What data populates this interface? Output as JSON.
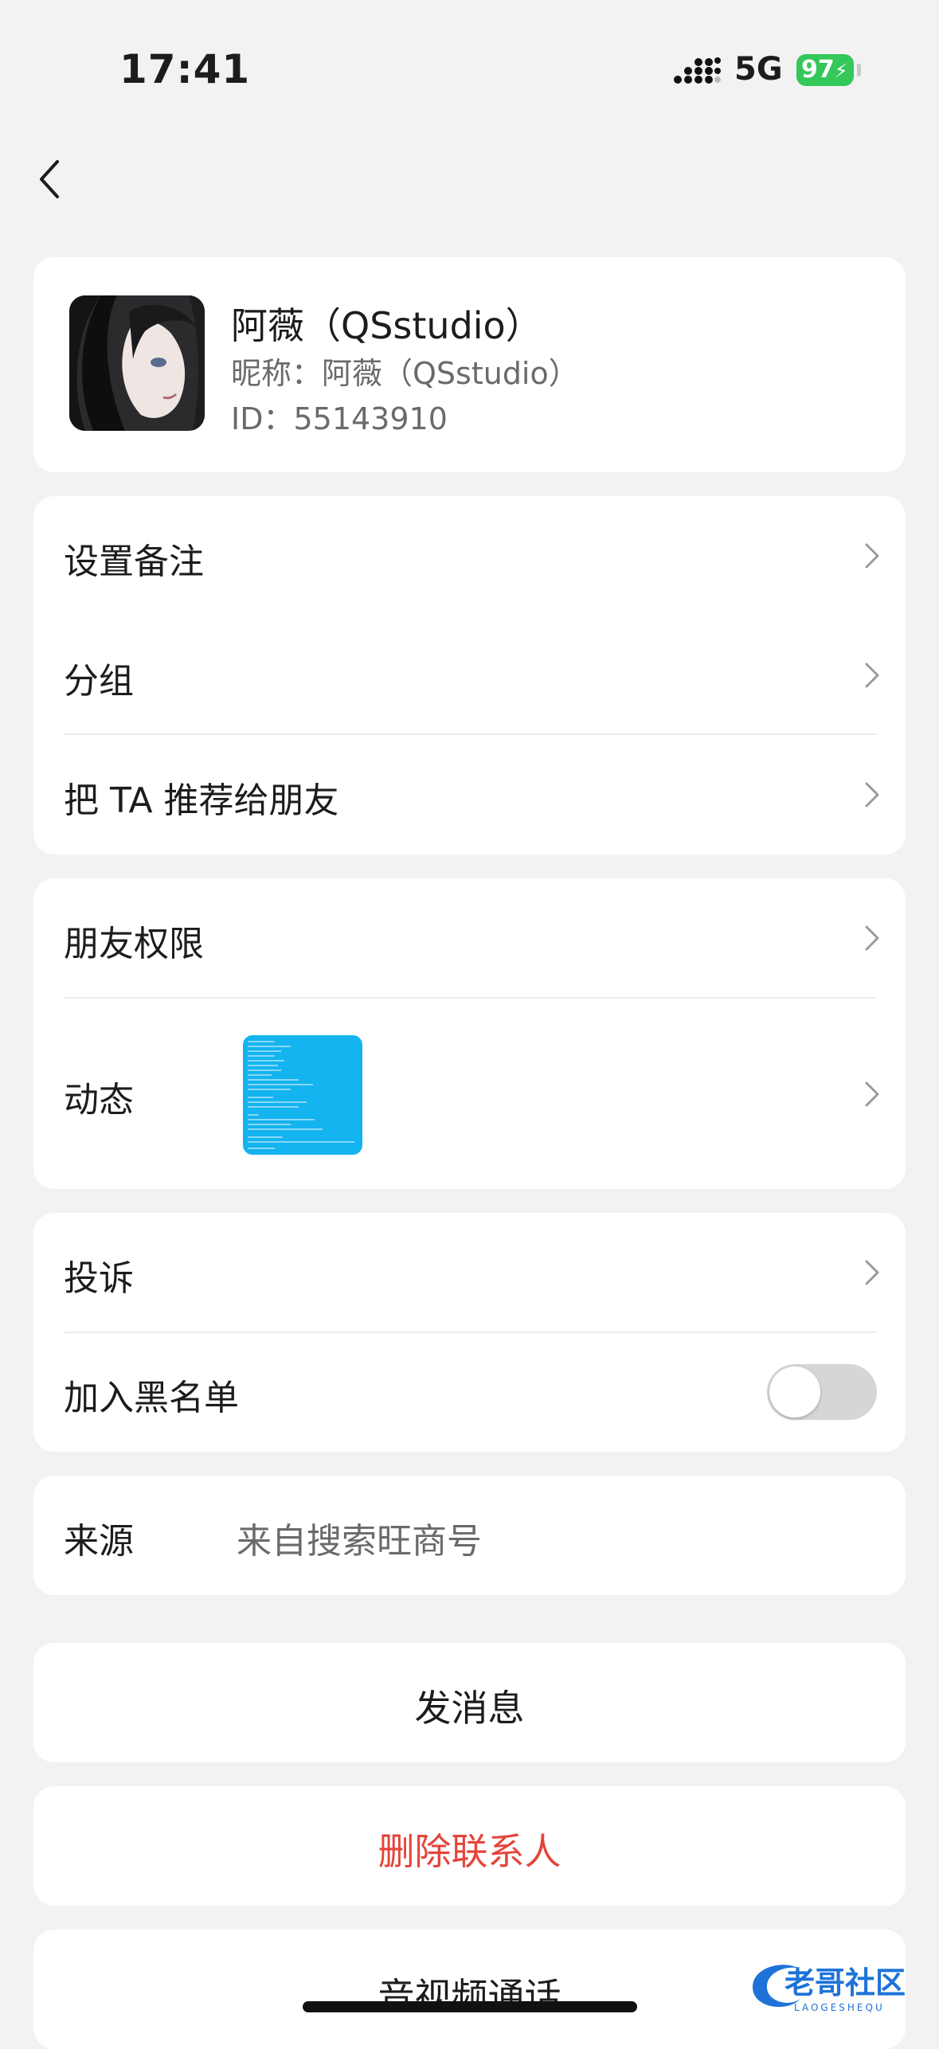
{
  "status_bar": {
    "time": "17:41",
    "network": "5G",
    "battery": "97"
  },
  "profile": {
    "name": "阿薇（QSstudio）",
    "nickname": "昵称：阿薇（QSstudio）",
    "id": "ID：55143910"
  },
  "settings_group": {
    "remark": "设置备注",
    "group": "分组",
    "recommend": "把 TA 推荐给朋友"
  },
  "permissions_group": {
    "friend_permission": "朋友权限",
    "moments": "动态"
  },
  "safety_group": {
    "report": "投诉",
    "blacklist": "加入黑名单",
    "blacklist_enabled": false
  },
  "source": {
    "label": "来源",
    "value": "来自搜索旺商号"
  },
  "actions": {
    "send_message": "发消息",
    "delete_contact": "删除联系人",
    "av_call": "音视频通话"
  },
  "watermark": {
    "brand": "老哥社区",
    "sub": "LAOGESHEQU"
  },
  "colors": {
    "background": "#f2f2f2",
    "card": "#ffffff",
    "danger": "#e5443a",
    "battery": "#34c759",
    "moments_thumb": "#13b4ef"
  }
}
